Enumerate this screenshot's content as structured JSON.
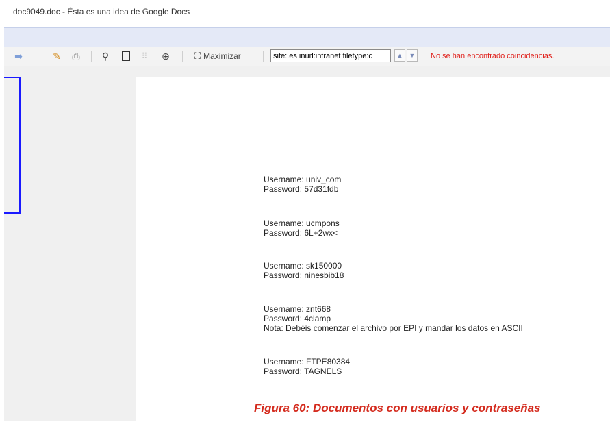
{
  "window_title": "doc9049.doc - Ésta es una idea de Google Docs",
  "toolbar": {
    "maximize_label": "Maximizar",
    "search_value": "site:.es inurl:intranet filetype:c",
    "no_match": "No se han encontrado coincidencias.",
    "icons": [
      "forward-arrow-icon",
      "edit-icon",
      "print-icon",
      "zoom-out-icon",
      "single-page-icon",
      "grid-view-icon",
      "zoom-in-icon",
      "maximize-icon",
      "prev-match-icon",
      "next-match-icon"
    ]
  },
  "document": {
    "entries": [
      {
        "user": "Username: univ_com",
        "pass": "Password: 57d31fdb"
      },
      {
        "user": "Username: ucmpons",
        "pass": "Password: 6L+2wx<"
      },
      {
        "user": "Username: sk150000",
        "pass": "Password: ninesbib18"
      },
      {
        "user": "Username: znt668",
        "pass": "Password: 4clamp",
        "note": "Nota: Debéis comenzar el archivo por EPI y mandar los datos en ASCII"
      },
      {
        "user": "Username: FTPE80384",
        "pass": "Password: TAGNELS"
      }
    ]
  },
  "caption": "Figura 60:  Documentos con usuarios y contraseñas"
}
